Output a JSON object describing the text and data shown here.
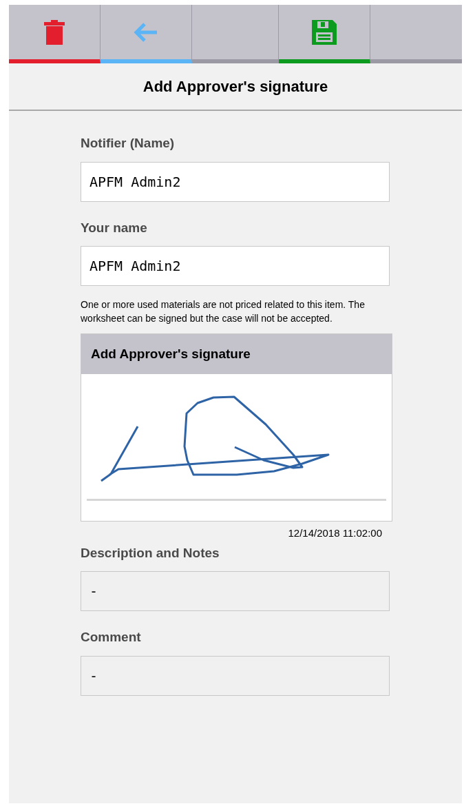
{
  "toolbar": [
    {
      "kind": "delete",
      "color": "#e31e2d"
    },
    {
      "kind": "back",
      "color": "#5ab4f5"
    },
    {
      "kind": "empty",
      "color": "#9b99a3"
    },
    {
      "kind": "save",
      "color": "#0c9a1f"
    },
    {
      "kind": "empty",
      "color": "#9b99a3"
    }
  ],
  "title": "Add Approver's signature",
  "fields": [
    {
      "label": "Notifier (Name)",
      "value": "APFM Admin2",
      "disabled": false
    },
    {
      "label": "Your name",
      "value": "APFM Admin2",
      "disabled": false
    }
  ],
  "notice": "One or more used materials are not priced related to this item. The worksheet can be signed but the case will not be accepted.",
  "signature": {
    "title": "Add Approver's signature",
    "timestamp": "12/14/2018 11:02:00"
  },
  "notes": [
    {
      "label": "Description and Notes",
      "value": "-",
      "disabled": true
    },
    {
      "label": "Comment",
      "value": "-",
      "disabled": true
    }
  ]
}
